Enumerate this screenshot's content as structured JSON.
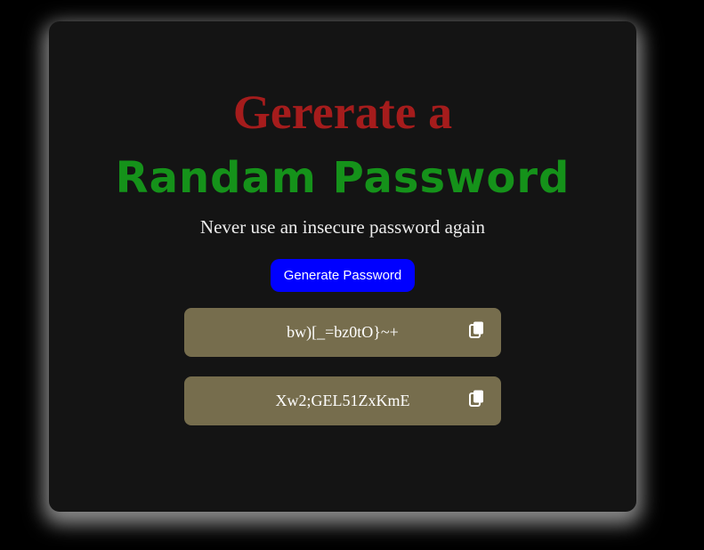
{
  "header": {
    "title_line1": "Gererate a",
    "title_line2": "Randam Password",
    "subtitle": "Never use an insecure password again"
  },
  "generate_button": {
    "label": "Generate Password",
    "color": "#0000ff"
  },
  "passwords": [
    {
      "value": "bw)[_=bz0tO}~+",
      "icon": "copy-icon"
    },
    {
      "value": "Xw2;GEL51ZxKmE",
      "icon": "copy-icon"
    }
  ],
  "colors": {
    "title_line1": "#a51c1c",
    "title_line2": "#15921a",
    "password_box": "#766d4d",
    "card_background": "#141414"
  }
}
